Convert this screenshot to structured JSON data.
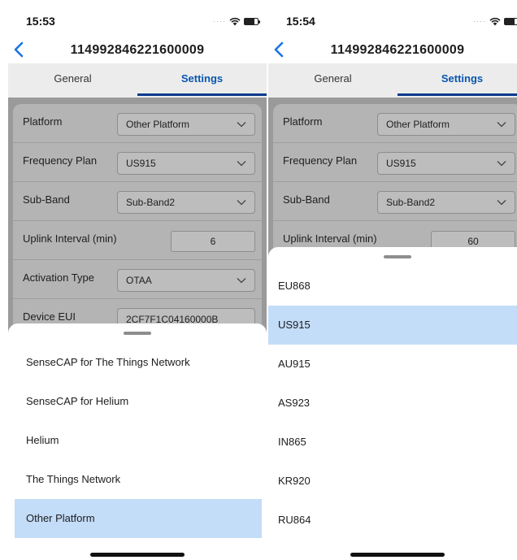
{
  "screens": [
    {
      "status": {
        "time": "15:53"
      },
      "nav": {
        "title": "114992846221600009"
      },
      "tabs": [
        {
          "label": "General"
        },
        {
          "label": "Settings"
        }
      ],
      "form": [
        {
          "label": "Platform",
          "value": "Other Platform",
          "kind": "select"
        },
        {
          "label": "Frequency Plan",
          "value": "US915",
          "kind": "select"
        },
        {
          "label": "Sub-Band",
          "value": "Sub-Band2",
          "kind": "select"
        },
        {
          "label": "Uplink Interval (min)",
          "value": "6",
          "kind": "input"
        },
        {
          "label": "Activation Type",
          "value": "OTAA",
          "kind": "select"
        },
        {
          "label": "Device EUI",
          "value": "2CF7F1C04160000B",
          "kind": "text"
        }
      ],
      "sheet": {
        "options": [
          {
            "label": "SenseCAP for The Things Network"
          },
          {
            "label": "SenseCAP for Helium"
          },
          {
            "label": "Helium"
          },
          {
            "label": "The Things Network"
          },
          {
            "label": "Other Platform"
          }
        ],
        "selected": "Other Platform"
      }
    },
    {
      "status": {
        "time": "15:54"
      },
      "nav": {
        "title": "114992846221600009"
      },
      "tabs": [
        {
          "label": "General"
        },
        {
          "label": "Settings"
        }
      ],
      "form": [
        {
          "label": "Platform",
          "value": "Other Platform",
          "kind": "select"
        },
        {
          "label": "Frequency Plan",
          "value": "US915",
          "kind": "select"
        },
        {
          "label": "Sub-Band",
          "value": "Sub-Band2",
          "kind": "select"
        },
        {
          "label": "Uplink Interval (min)",
          "value": "60",
          "kind": "input"
        }
      ],
      "sheet": {
        "options": [
          {
            "label": "EU868"
          },
          {
            "label": "US915"
          },
          {
            "label": "AU915"
          },
          {
            "label": "AS923"
          },
          {
            "label": "IN865"
          },
          {
            "label": "KR920"
          },
          {
            "label": "RU864"
          }
        ],
        "selected": "US915"
      }
    }
  ],
  "colors": {
    "accent": "#0a56b0",
    "tab_indicator": "#0a3a8c",
    "selected_row": "#c3dcf7"
  }
}
